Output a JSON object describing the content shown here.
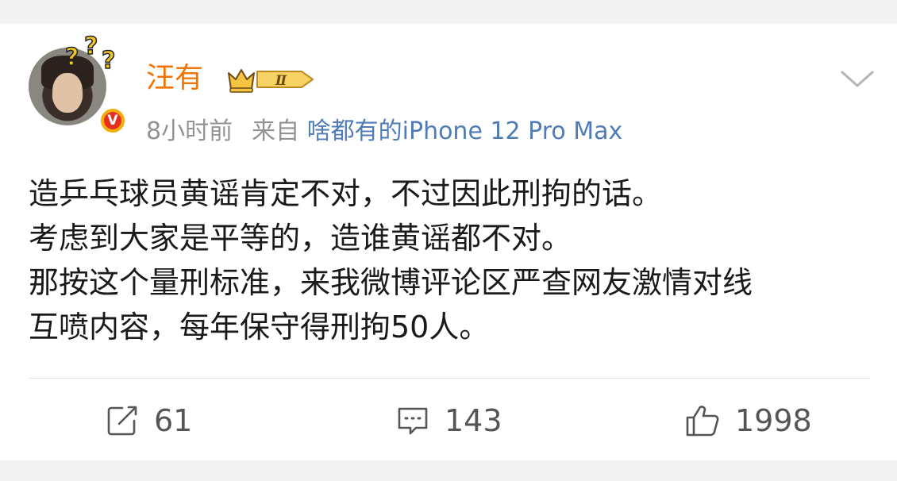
{
  "post": {
    "username": "汪有",
    "vip_level": "Ⅱ",
    "time": "8小时前",
    "source_prefix": "来自",
    "source": "啥都有的iPhone 12 Pro Max",
    "text_lines": [
      "造乒乓球员黄谣肯定不对，不过因此刑拘的话。",
      "考虑到大家是平等的，造谁黄谣都不对。",
      "那按这个量刑标准，来我微博评论区严查网友激情对线",
      "互喷内容，每年保守得刑拘50人。"
    ]
  },
  "actions": {
    "repost_count": "61",
    "comment_count": "143",
    "like_count": "1998"
  },
  "icons": {
    "avatar_badge": "verified-v-icon",
    "crown": "vip-crown-icon",
    "menu": "chevron-down-icon",
    "repost": "repost-icon",
    "comment": "comment-icon",
    "like": "thumbs-up-icon"
  },
  "colors": {
    "username": "#f17400",
    "source_link": "#4f7bb6",
    "meta_gray": "#939393",
    "text": "#1a1a1a",
    "background": "#f2f2f2"
  }
}
